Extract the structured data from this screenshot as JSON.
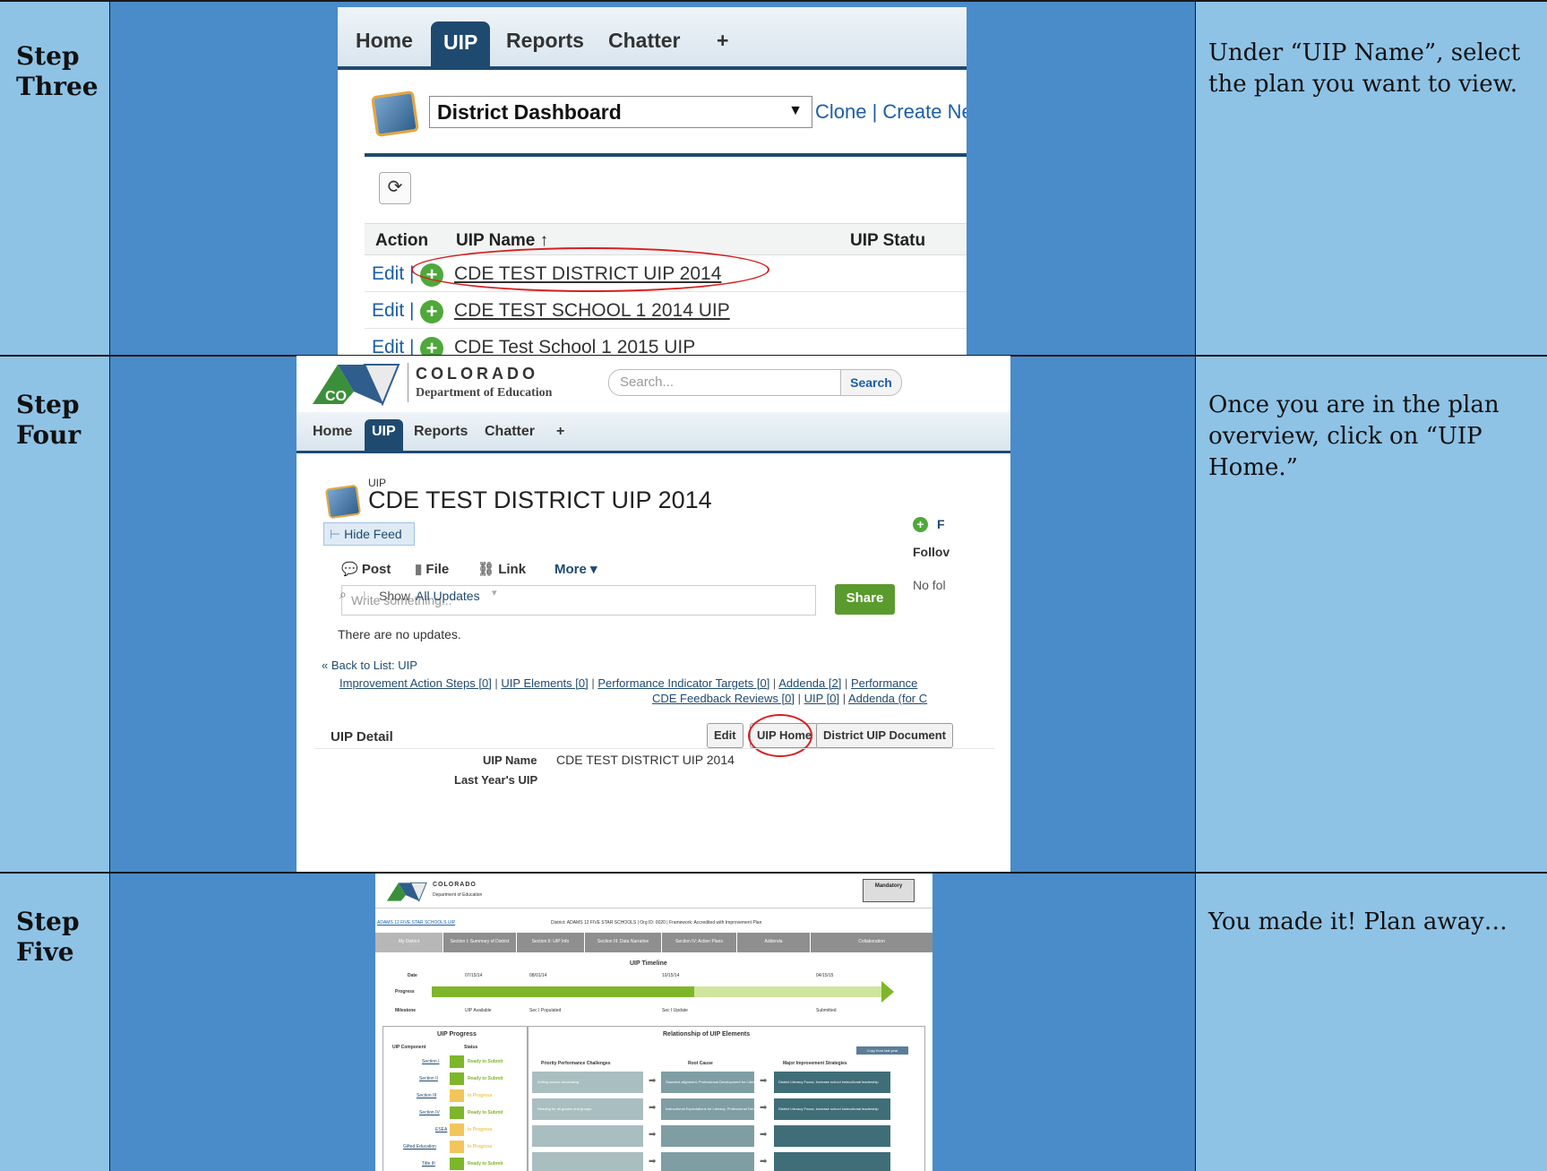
{
  "rows": [
    {
      "step": "Step\nThree",
      "description": "Under “UIP Name”, select the plan you want to view."
    },
    {
      "step": "Step\nFour",
      "description": "Once you are in the plan overview, click on “UIP Home.”"
    },
    {
      "step": "Step\nFive",
      "description": "You made it!  Plan away…"
    }
  ],
  "step3": {
    "tabs": [
      "Home",
      "UIP",
      "Reports",
      "Chatter",
      "+"
    ],
    "view_select": "District Dashboard",
    "view_links": "Clone | Create Ne",
    "columns": [
      "Action",
      "UIP Name ↑",
      "UIP Statu"
    ],
    "rows": [
      {
        "action": "Edit |",
        "name": "CDE TEST DISTRICT UIP 2014"
      },
      {
        "action": "Edit |",
        "name": "CDE TEST SCHOOL 1 2014 UIP"
      },
      {
        "action": "Edit |",
        "name": "CDE Test School 1 2015 UIP"
      }
    ]
  },
  "step4": {
    "org_name": "COLORADO",
    "org_sub": "Department of Education",
    "search_placeholder": "Search...",
    "search_button": "Search",
    "tabs": [
      "Home",
      "UIP",
      "Reports",
      "Chatter",
      "+"
    ],
    "record_type": "UIP",
    "record_title": "CDE TEST DISTRICT UIP 2014",
    "hide_feed": "Hide Feed",
    "publisher_tabs": [
      "Post",
      "File",
      "Link",
      "More ▾"
    ],
    "write_placeholder": "Write something...",
    "share": "Share",
    "follow_cut": "F",
    "followers_cut": "Follov",
    "no_followers_cut": "No fol",
    "show_label": "Show",
    "show_value": "All Updates",
    "no_updates": "There are no updates.",
    "back_to_list": "« Back to List: UIP",
    "related_line1": [
      "Improvement Action Steps [0]",
      "UIP Elements [0]",
      "Performance Indicator Targets [0]",
      "Addenda [2]",
      "Performance"
    ],
    "related_line2": [
      "CDE Feedback Reviews [0]",
      "UIP [0]",
      "Addenda (for C"
    ],
    "detail_title": "UIP Detail",
    "buttons": [
      "Edit",
      "UIP Home",
      "District UIP Document"
    ],
    "field_label_1": "UIP Name",
    "field_value_1": "CDE TEST DISTRICT UIP 2014",
    "field_label_2": "Last Year's UIP"
  },
  "step5": {
    "org_name": "COLORADO",
    "org_sub": "Department of Education",
    "breadcrumb": "ADAMS 12 FIVE STAR SCHOOLS UIP",
    "district_line": "District: ADAMS 12 FIVE STAR SCHOOLS  |  Org ID: 0020  |  Framework: Accredited with Improvement Plan",
    "tabs": [
      "My District",
      "Section I: Summary of District",
      "Section II: UIP Info",
      "Section III: Data Narrative",
      "Section IV: Action Plans",
      "Addenda",
      "Collaboration"
    ],
    "timeline_title": "UIP Timeline",
    "timeline_rows": [
      "Date",
      "Progress",
      "Milestone"
    ],
    "dates": [
      "07/15/14",
      "08/01/14",
      "10/15/14",
      "04/15/15"
    ],
    "milestones": [
      "UIP Available",
      "Sec I Populated",
      "Sec I Update",
      "Submitted"
    ],
    "progress_fraction": 0.58,
    "progress_title": "UIP Progress",
    "progress_cols": [
      "UIP Component",
      "Status"
    ],
    "components": [
      {
        "name": "Section I",
        "status": "Ready to Submit",
        "color": "#7eb62a"
      },
      {
        "name": "Section II",
        "status": "Ready to Submit",
        "color": "#7eb62a"
      },
      {
        "name": "Section III",
        "status": "In Progress",
        "color": "#f2c55c"
      },
      {
        "name": "Section IV",
        "status": "Ready to Submit",
        "color": "#7eb62a"
      },
      {
        "name": "ESEA",
        "status": "In Progress",
        "color": "#f2c55c"
      },
      {
        "name": "Gifted Education",
        "status": "In Progress",
        "color": "#f2c55c"
      },
      {
        "name": "Title III",
        "status": "Ready to Submit",
        "color": "#7eb62a"
      }
    ],
    "relationship_title": "Relationship of UIP Elements",
    "copy_button": "Copy from last year",
    "rel_cols": [
      "Priority Performance Challenges",
      "Root Cause",
      "Major Improvement Strategies"
    ],
    "rel_rows": [
      {
        "challenge": "Writing scores decreasing",
        "cause": "Standard alignment; Professional Development for Literacy",
        "strategy": "District Literacy Focus; Increase school instructional leadership"
      },
      {
        "challenge": "Reading for all grades and groups",
        "cause": "Instructional Expectations for Literacy; Professional Development for Literacy",
        "strategy": "District Literacy Focus; Increase school instructional leadership"
      },
      {
        "challenge": "",
        "cause": "",
        "strategy": ""
      },
      {
        "challenge": "",
        "cause": "",
        "strategy": ""
      }
    ],
    "stamp": "Mandatory"
  },
  "colors": {
    "step_cell": "#8ec3e6",
    "image_cell": "#4a8bc9",
    "nav_dark": "#1f4a70",
    "highlight": "#d62020",
    "ready": "#7eb62a",
    "in_progress": "#f2c55c"
  }
}
